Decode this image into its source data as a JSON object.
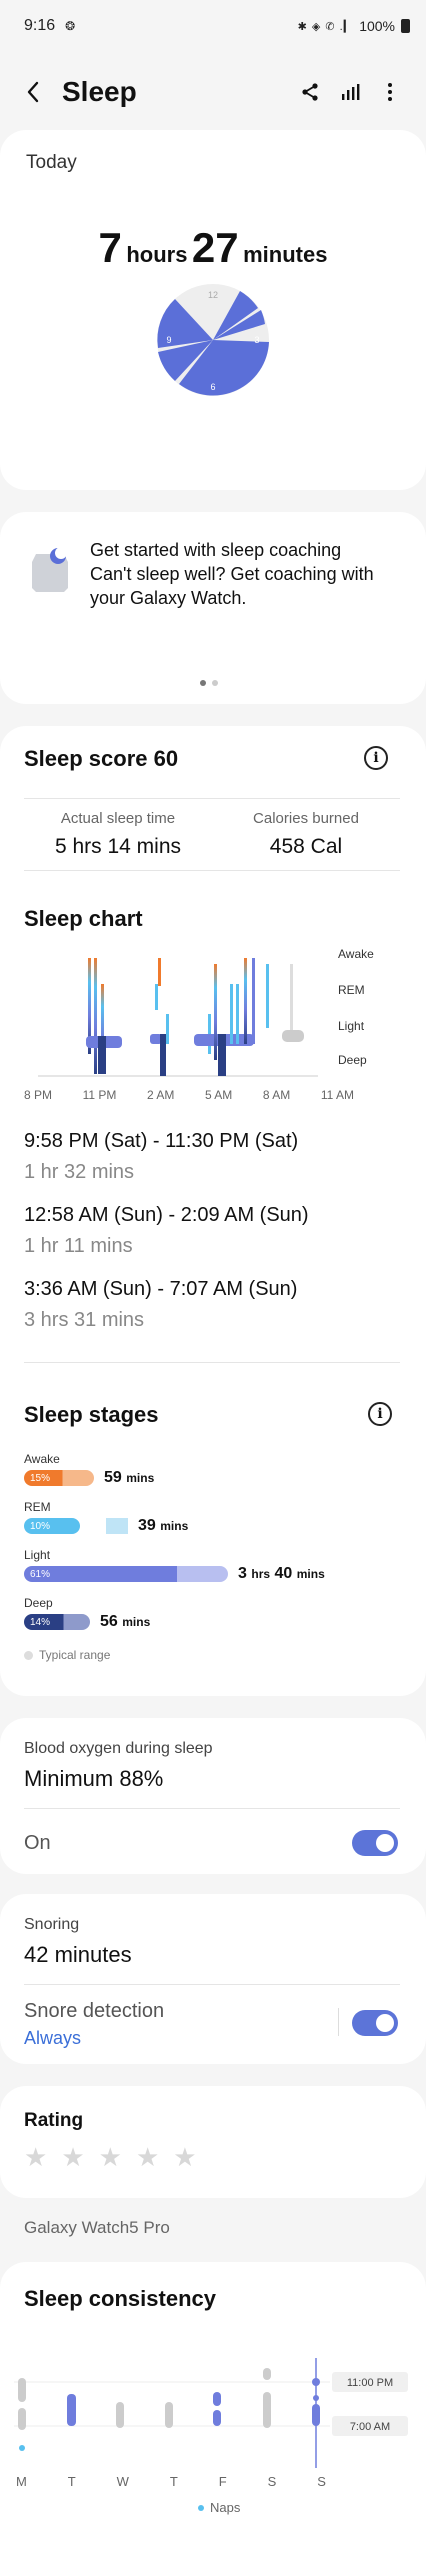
{
  "status": {
    "time": "9:16",
    "icons_left": "❂",
    "signal": "✱ ◈ ✆ .▎",
    "battery": "100%"
  },
  "appbar": {
    "title": "Sleep"
  },
  "today": {
    "label": "Today",
    "hours": "7",
    "hours_unit": "hours",
    "minutes": "27",
    "minutes_unit": "minutes",
    "clock_labels": [
      "12",
      "3",
      "6",
      "9"
    ]
  },
  "coaching": {
    "title": "Get started with sleep coaching",
    "subtitle": "Can't sleep well? Get coaching with your Galaxy Watch."
  },
  "score": {
    "title": "Sleep score 60",
    "actual_label": "Actual sleep time",
    "actual_value": "5 hrs 14 mins",
    "calories_label": "Calories burned",
    "calories_value": "458 Cal"
  },
  "chart": {
    "title": "Sleep chart",
    "y_labels": [
      "Awake",
      "REM",
      "Light",
      "Deep"
    ],
    "x_labels": [
      "8 PM",
      "11 PM",
      "2 AM",
      "5 AM",
      "8 AM",
      "11 AM"
    ]
  },
  "segments": [
    {
      "time": "9:58 PM (Sat) - 11:30 PM (Sat)",
      "duration": "1 hr 32 mins"
    },
    {
      "time": "12:58 AM (Sun) - 2:09 AM (Sun)",
      "duration": "1 hr 11 mins"
    },
    {
      "time": "3:36 AM (Sun) - 7:07 AM (Sun)",
      "duration": "3 hrs 31 mins"
    }
  ],
  "stages": {
    "title": "Sleep stages",
    "awake": {
      "name": "Awake",
      "pct": "15%",
      "value": "59",
      "unit": "mins",
      "color": "#f07a2c"
    },
    "rem": {
      "name": "REM",
      "pct": "10%",
      "value": "39",
      "unit": "mins",
      "color": "#58c0ef"
    },
    "light": {
      "name": "Light",
      "pct": "61%",
      "value": "3",
      "unit1": "hrs",
      "value2": "40",
      "unit2": "mins",
      "color": "#6f7ddd"
    },
    "deep": {
      "name": "Deep",
      "pct": "14%",
      "value": "56",
      "unit": "mins",
      "color": "#2a3f84"
    },
    "typical": "Typical range"
  },
  "oxygen": {
    "label": "Blood oxygen during sleep",
    "value": "Minimum 88%",
    "toggle_label": "On"
  },
  "snoring": {
    "label": "Snoring",
    "value": "42 minutes",
    "detect_label": "Snore detection",
    "detect_value": "Always"
  },
  "rating": {
    "title": "Rating"
  },
  "device": {
    "name": "Galaxy Watch5 Pro"
  },
  "consistency": {
    "title": "Sleep consistency",
    "time_labels": [
      "11:00 PM",
      "7:00 AM"
    ],
    "days": [
      "M",
      "T",
      "W",
      "T",
      "F",
      "S",
      "S"
    ],
    "legend": "Naps"
  }
}
